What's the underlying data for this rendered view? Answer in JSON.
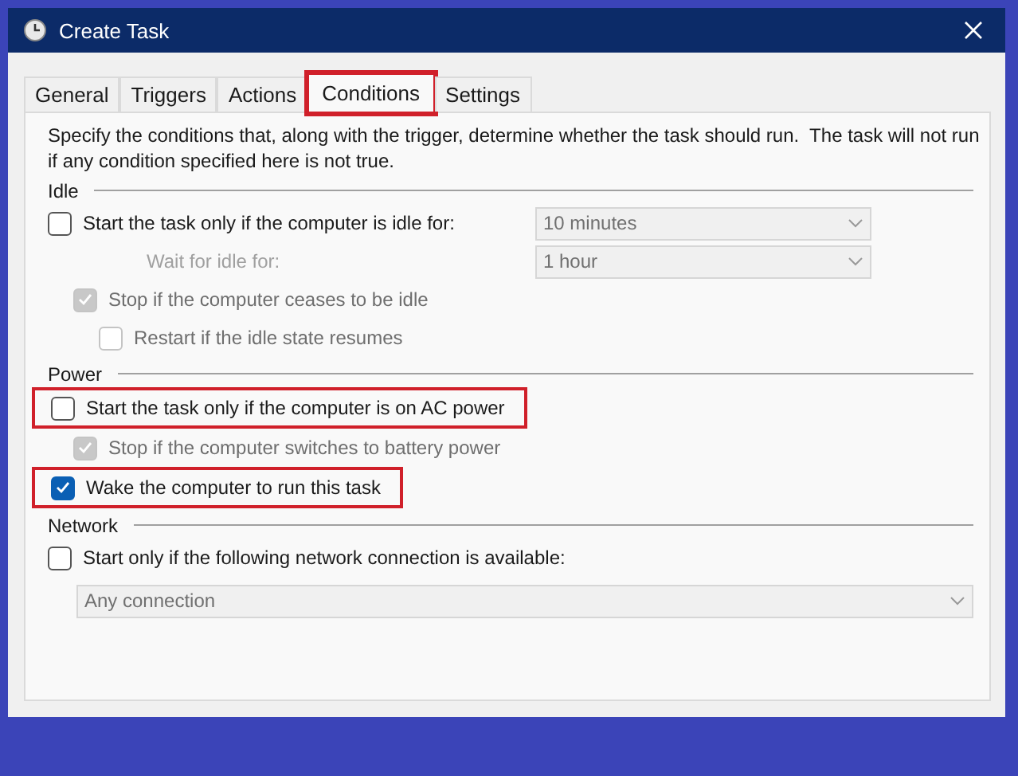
{
  "window": {
    "title": "Create Task"
  },
  "tabs": [
    {
      "label": "General",
      "selected": false,
      "highlighted": false
    },
    {
      "label": "Triggers",
      "selected": false,
      "highlighted": false
    },
    {
      "label": "Actions",
      "selected": false,
      "highlighted": false
    },
    {
      "label": "Conditions",
      "selected": true,
      "highlighted": true
    },
    {
      "label": "Settings",
      "selected": false,
      "highlighted": false
    }
  ],
  "description": "Specify the conditions that, along with the trigger, determine whether the task should run.  The task will not run  if any condition specified here is not true.",
  "sections": [
    {
      "title": "Idle",
      "items": [
        {
          "kind": "checkbox",
          "label": "Start the task only if the computer is idle for:",
          "checked": false,
          "disabled": false,
          "highlighted": false,
          "dropdown": {
            "value": "10 minutes",
            "disabled": true
          },
          "children": [
            {
              "kind": "field",
              "label": "Wait for idle for:",
              "disabled": true,
              "dropdown": {
                "value": "1 hour",
                "disabled": true
              }
            },
            {
              "kind": "checkbox",
              "label": "Stop if the computer ceases to be idle",
              "checked": true,
              "disabled": true,
              "highlighted": false,
              "children": [
                {
                  "kind": "checkbox",
                  "label": "Restart if the idle state resumes",
                  "checked": false,
                  "disabled": true,
                  "highlighted": false
                }
              ]
            }
          ]
        }
      ]
    },
    {
      "title": "Power",
      "items": [
        {
          "kind": "checkbox",
          "label": "Start the task only if the computer is on AC power",
          "checked": false,
          "disabled": false,
          "highlighted": true,
          "children": [
            {
              "kind": "checkbox",
              "label": "Stop if the computer switches to battery power",
              "checked": true,
              "disabled": true,
              "highlighted": false
            }
          ]
        },
        {
          "kind": "checkbox",
          "label": "Wake the computer to run this task",
          "checked": true,
          "disabled": false,
          "highlighted": true
        }
      ]
    },
    {
      "title": "Network",
      "items": [
        {
          "kind": "checkbox",
          "label": "Start only if the following network connection is available:",
          "checked": false,
          "disabled": false,
          "highlighted": false,
          "children": [
            {
              "kind": "dropdown",
              "value": "Any connection",
              "disabled": true
            }
          ]
        }
      ]
    }
  ]
}
